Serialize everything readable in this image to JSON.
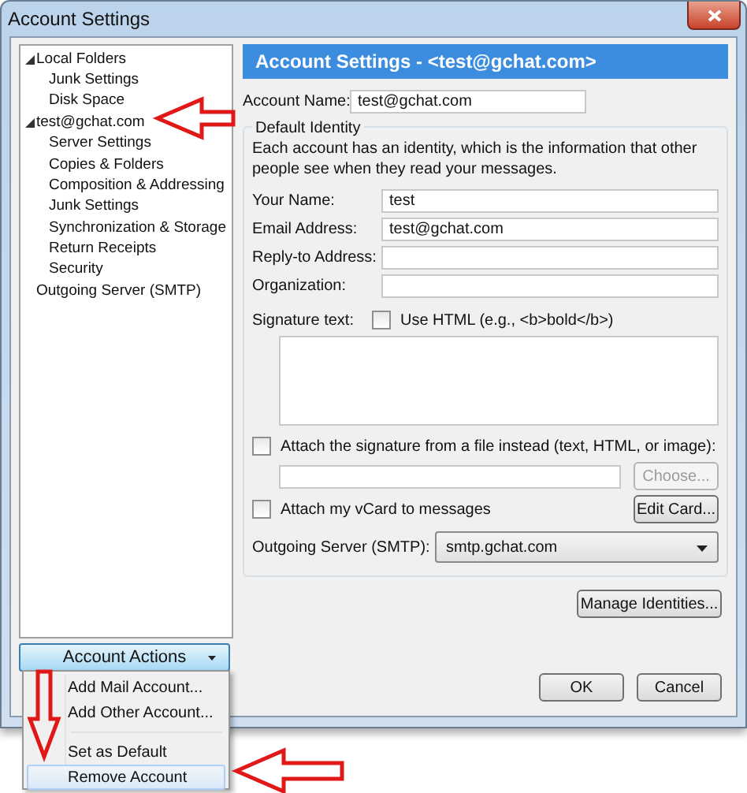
{
  "window": {
    "title": "Account Settings"
  },
  "tree": [
    {
      "label": "Local Folders",
      "expanded": true,
      "selected": false,
      "children": [
        {
          "label": "Junk Settings",
          "selected": false
        },
        {
          "label": "Disk Space",
          "selected": false
        }
      ]
    },
    {
      "label": "test@gchat.com",
      "expanded": true,
      "selected": false,
      "children": [
        {
          "label": "Server Settings",
          "selected": false
        },
        {
          "label": "Copies & Folders",
          "selected": false
        },
        {
          "label": "Composition & Addressing",
          "selected": false
        },
        {
          "label": "Junk Settings",
          "selected": false
        },
        {
          "label": "Synchronization & Storage",
          "selected": false
        },
        {
          "label": "Return Receipts",
          "selected": false
        },
        {
          "label": "Security",
          "selected": false
        }
      ]
    },
    {
      "label": "Outgoing Server (SMTP)",
      "selected": false
    }
  ],
  "account_actions": {
    "label": "Account Actions",
    "expanded": true
  },
  "menu": [
    {
      "kind": "item",
      "label": "Add Mail Account...",
      "selected": false
    },
    {
      "kind": "item",
      "label": "Add Other Account...",
      "selected": false
    },
    {
      "kind": "separator"
    },
    {
      "kind": "item",
      "label": "Set as Default",
      "selected": false
    },
    {
      "kind": "item",
      "label": "Remove Account",
      "selected": true
    }
  ],
  "header": "Account Settings - <test@gchat.com>",
  "account_name": {
    "label": "Account Name:",
    "value": "test@gchat.com"
  },
  "identity": {
    "title": "Default Identity",
    "description": "Each account has an identity, which is the information that other people see when they read your messages.",
    "fields": [
      {
        "label": "Your Name:",
        "value": "test"
      },
      {
        "label": "Email Address:",
        "value": "test@gchat.com"
      },
      {
        "label": "Reply-to Address:"
      },
      {
        "label": "Organization:"
      }
    ],
    "signature_label": "Signature text:",
    "use_html": {
      "label": "Use HTML (e.g., <b>bold</b>)",
      "checked": false
    },
    "attach_file": {
      "label": "Attach the signature from a file instead (text, HTML, or image):",
      "checked": false
    },
    "choose_button": {
      "label": "Choose...",
      "disabled": true
    },
    "vcard": {
      "label": "Attach my vCard to messages",
      "checked": false
    },
    "edit_card": "Edit Card...",
    "smtp": {
      "label": "Outgoing Server (SMTP):",
      "value": "smtp.gchat.com"
    }
  },
  "manage_identities": "Manage Identities...",
  "buttons": [
    "OK",
    "Cancel"
  ]
}
